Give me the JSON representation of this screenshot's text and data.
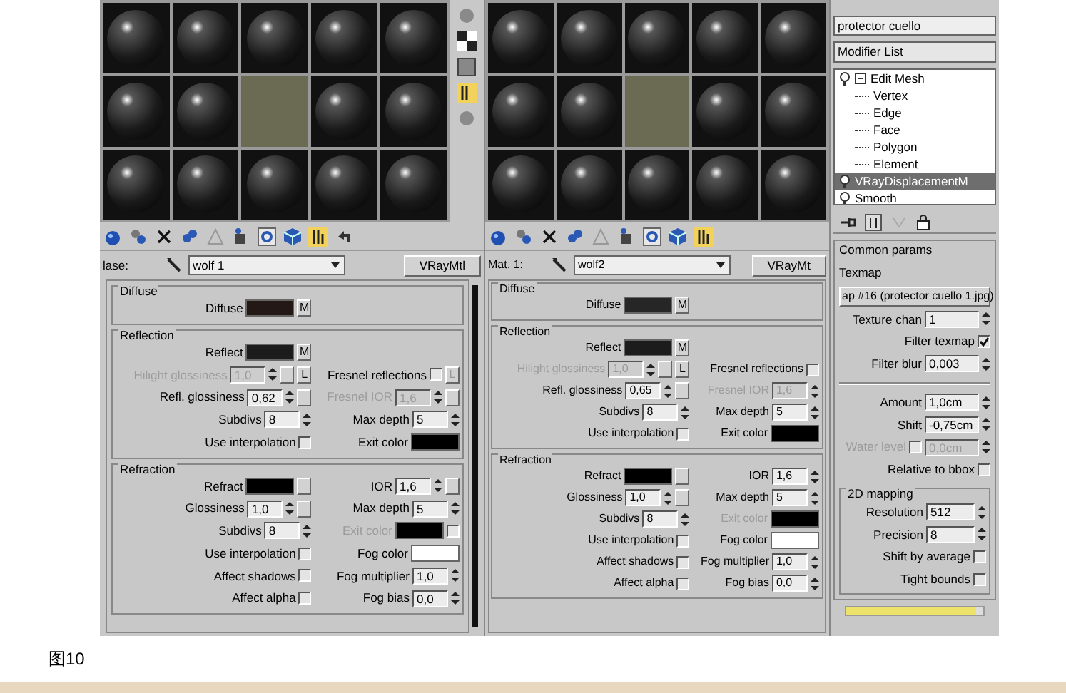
{
  "editors": [
    {
      "slot_label": "lase:",
      "material_name": "wolf 1",
      "material_type": "VRayMtl",
      "groups": [
        {
          "title": "Diffuse",
          "rows": [
            {
              "left": {
                "kind": "color",
                "label": "Diffuse",
                "color": "#231815",
                "disabled": false,
                "map_button": true,
                "map_label": "M"
              }
            }
          ]
        },
        {
          "title": "Reflection",
          "rows": [
            {
              "left": {
                "kind": "color",
                "label": "Reflect",
                "color": "#1c1c1c",
                "disabled": false,
                "map_button": true,
                "map_label": "M"
              }
            },
            {
              "left": {
                "kind": "spinner",
                "label": "Hilight glossiness",
                "value": "1,0",
                "disabled": true,
                "map_button": true,
                "lock_label": "L",
                "lock_disabled": false
              },
              "right": {
                "kind": "check",
                "label": "Fresnel reflections",
                "checked": false,
                "disabled": false,
                "lock_label": "L",
                "lock_disabled": true
              }
            },
            {
              "left": {
                "kind": "spinner",
                "label": "Refl. glossiness",
                "value": "0,62",
                "disabled": false,
                "map_button": true
              },
              "right": {
                "kind": "spinner",
                "label": "Fresnel IOR",
                "value": "1,6",
                "disabled": true,
                "map_button": true
              }
            },
            {
              "left": {
                "kind": "spinner",
                "label": "Subdivs",
                "value": "8",
                "disabled": false
              },
              "right": {
                "kind": "spinner",
                "label": "Max depth",
                "value": "5",
                "disabled": false
              }
            },
            {
              "left": {
                "kind": "check",
                "label": "Use interpolation",
                "checked": false,
                "disabled": false
              },
              "right": {
                "kind": "color",
                "label": "Exit color",
                "color": "#000000",
                "disabled": false
              }
            }
          ]
        },
        {
          "title": "Refraction",
          "rows": [
            {
              "left": {
                "kind": "color",
                "label": "Refract",
                "color": "#000000",
                "disabled": false,
                "map_button": true
              },
              "right": {
                "kind": "spinner",
                "label": "IOR",
                "value": "1,6",
                "disabled": false,
                "map_button": true
              }
            },
            {
              "left": {
                "kind": "spinner",
                "label": "Glossiness",
                "value": "1,0",
                "disabled": false,
                "map_button": true
              },
              "right": {
                "kind": "spinner",
                "label": "Max depth",
                "value": "5",
                "disabled": false
              }
            },
            {
              "left": {
                "kind": "spinner",
                "label": "Subdivs",
                "value": "8",
                "disabled": false
              },
              "right": {
                "kind": "color",
                "label": "Exit color",
                "color": "#000000",
                "disabled": true,
                "trailing_check": true,
                "checked": false
              }
            },
            {
              "left": {
                "kind": "check",
                "label": "Use interpolation",
                "checked": false,
                "disabled": false
              },
              "right": {
                "kind": "color",
                "label": "Fog color",
                "color": "#ffffff",
                "disabled": false
              }
            },
            {
              "left": {
                "kind": "check",
                "label": "Affect shadows",
                "checked": false,
                "disabled": false
              },
              "right": {
                "kind": "spinner",
                "label": "Fog multiplier",
                "value": "1,0",
                "disabled": false
              }
            },
            {
              "left": {
                "kind": "check",
                "label": "Affect alpha",
                "checked": false,
                "disabled": false
              },
              "right": {
                "kind": "spinner",
                "label": "Fog bias",
                "value": "0,0",
                "disabled": false
              }
            }
          ]
        }
      ]
    },
    {
      "slot_label": "Mat. 1:",
      "material_name": "wolf2",
      "material_type": "VRayMt",
      "groups": [
        {
          "title": "Diffuse",
          "rows": [
            {
              "left": {
                "kind": "color",
                "label": "Diffuse",
                "color": "#262626",
                "disabled": false,
                "map_button": true,
                "map_label": "M"
              }
            }
          ]
        },
        {
          "title": "Reflection",
          "rows": [
            {
              "left": {
                "kind": "color",
                "label": "Reflect",
                "color": "#1c1c1c",
                "disabled": false,
                "map_button": true,
                "map_label": "M"
              }
            },
            {
              "left": {
                "kind": "spinner",
                "label": "Hilight glossiness",
                "value": "1,0",
                "disabled": true,
                "map_button": true,
                "lock_label": "L",
                "lock_disabled": false
              },
              "right": {
                "kind": "check",
                "label": "Fresnel reflections",
                "checked": false,
                "disabled": false
              }
            },
            {
              "left": {
                "kind": "spinner",
                "label": "Refl. glossiness",
                "value": "0,65",
                "disabled": false,
                "map_button": true
              },
              "right": {
                "kind": "spinner",
                "label": "Fresnel IOR",
                "value": "1,6",
                "disabled": true
              }
            },
            {
              "left": {
                "kind": "spinner",
                "label": "Subdivs",
                "value": "8",
                "disabled": false
              },
              "right": {
                "kind": "spinner",
                "label": "Max depth",
                "value": "5",
                "disabled": false
              }
            },
            {
              "left": {
                "kind": "check",
                "label": "Use interpolation",
                "checked": false,
                "disabled": false
              },
              "right": {
                "kind": "color",
                "label": "Exit color",
                "color": "#000000",
                "disabled": false
              }
            }
          ]
        },
        {
          "title": "Refraction",
          "rows": [
            {
              "left": {
                "kind": "color",
                "label": "Refract",
                "color": "#000000",
                "disabled": false,
                "map_button": true
              },
              "right": {
                "kind": "spinner",
                "label": "IOR",
                "value": "1,6",
                "disabled": false
              }
            },
            {
              "left": {
                "kind": "spinner",
                "label": "Glossiness",
                "value": "1,0",
                "disabled": false,
                "map_button": true
              },
              "right": {
                "kind": "spinner",
                "label": "Max depth",
                "value": "5",
                "disabled": false
              }
            },
            {
              "left": {
                "kind": "spinner",
                "label": "Subdivs",
                "value": "8",
                "disabled": false
              },
              "right": {
                "kind": "color",
                "label": "Exit color",
                "color": "#000000",
                "disabled": true
              }
            },
            {
              "left": {
                "kind": "check",
                "label": "Use interpolation",
                "checked": false,
                "disabled": false
              },
              "right": {
                "kind": "color",
                "label": "Fog color",
                "color": "#ffffff",
                "disabled": false
              }
            },
            {
              "left": {
                "kind": "check",
                "label": "Affect shadows",
                "checked": false,
                "disabled": false
              },
              "right": {
                "kind": "spinner",
                "label": "Fog multiplier",
                "value": "1,0",
                "disabled": false
              }
            },
            {
              "left": {
                "kind": "check",
                "label": "Affect alpha",
                "checked": false,
                "disabled": false
              },
              "right": {
                "kind": "spinner",
                "label": "Fog bias",
                "value": "0,0",
                "disabled": false
              }
            }
          ]
        }
      ]
    }
  ],
  "modifier_panel": {
    "object_name": "protector cuello",
    "modifier_list": "Modifier List",
    "stack": [
      {
        "label": "Edit Mesh",
        "expanded": true,
        "selected": false,
        "children": [
          {
            "label": "Vertex"
          },
          {
            "label": "Edge"
          },
          {
            "label": "Face"
          },
          {
            "label": "Polygon"
          },
          {
            "label": "Element"
          }
        ]
      },
      {
        "label": "VRayDisplacementM",
        "selected": true
      },
      {
        "label": "Smooth",
        "selected": false
      }
    ],
    "rollout_title": "Common params",
    "texmap_label": "Texmap",
    "texmap_button": "ap #16 (protector cuello 1.jpg)",
    "rows": [
      {
        "kind": "spinner",
        "label": "Texture chan",
        "value": "1",
        "disabled": false
      },
      {
        "kind": "check",
        "label": "Filter texmap",
        "checked": true,
        "disabled": false
      },
      {
        "kind": "spinner",
        "label": "Filter blur",
        "value": "0,003",
        "disabled": false
      },
      {
        "kind": "separator"
      },
      {
        "kind": "spinner",
        "label": "Amount",
        "value": "1,0cm",
        "disabled": false
      },
      {
        "kind": "spinner",
        "label": "Shift",
        "value": "-0,75cm",
        "disabled": false
      },
      {
        "kind": "check_spinner",
        "label": "Water level",
        "checked": false,
        "value": "0,0cm",
        "disabled": true
      },
      {
        "kind": "check",
        "label": "Relative to bbox",
        "checked": false,
        "disabled": false
      }
    ],
    "group": {
      "title": "2D mapping",
      "rows": [
        {
          "kind": "spinner",
          "label": "Resolution",
          "value": "512",
          "disabled": false
        },
        {
          "kind": "spinner",
          "label": "Precision",
          "value": "8",
          "disabled": false
        },
        {
          "kind": "check",
          "label": "Shift by average",
          "checked": false,
          "disabled": false
        },
        {
          "kind": "check",
          "label": "Tight bounds",
          "checked": false,
          "disabled": false
        }
      ]
    }
  },
  "time_slider": {
    "level": 0.95
  },
  "figure_label": "图10"
}
